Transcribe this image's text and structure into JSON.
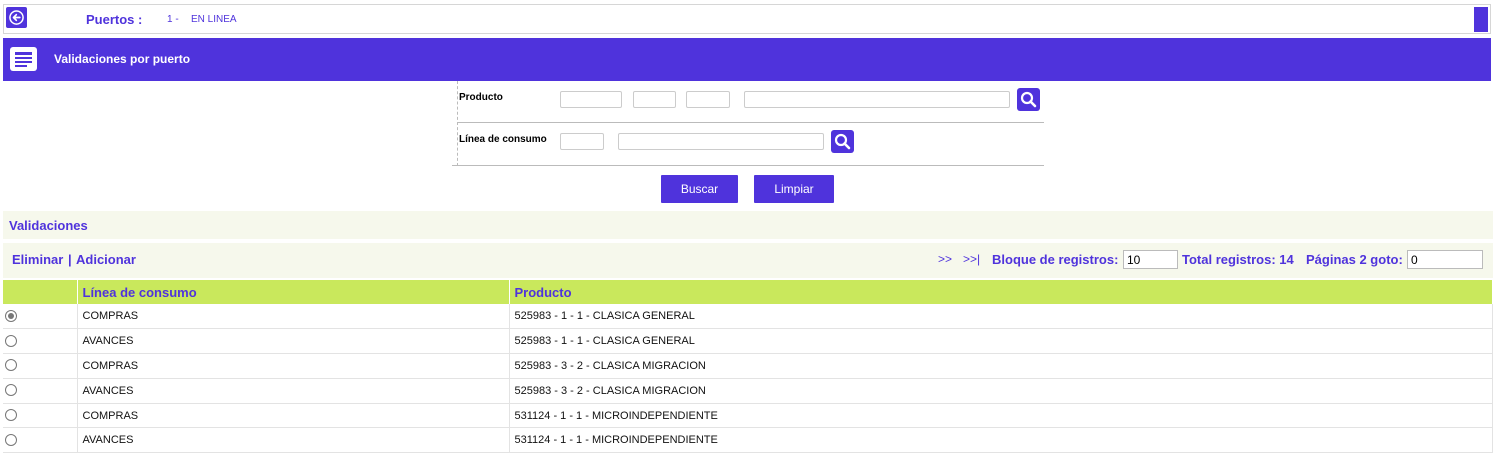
{
  "topbar": {
    "label": "Puertos :",
    "number": "1 -",
    "status": "EN LINEA"
  },
  "section": {
    "title": "Validaciones por puerto"
  },
  "filter": {
    "producto_label": "Producto",
    "linea_label": "Línea de consumo",
    "producto_values": [
      "",
      "",
      "",
      ""
    ],
    "linea_values": [
      "",
      ""
    ]
  },
  "actions": {
    "buscar": "Buscar",
    "limpiar": "Limpiar"
  },
  "validaciones": {
    "title": "Validaciones",
    "eliminar": "Eliminar",
    "separator": "|",
    "adicionar": "Adicionar",
    "next": ">>",
    "last": ">>|",
    "bloque_label": "Bloque de registros:",
    "bloque_value": "10",
    "total_label": "Total registros: 14",
    "paginas_label": "Páginas 2 goto:",
    "goto_value": "0"
  },
  "table": {
    "columns": [
      "",
      "Línea de consumo",
      "Producto"
    ],
    "rows": [
      {
        "selected": true,
        "linea": "COMPRAS",
        "producto": "525983 - 1 - 1 - CLASICA GENERAL"
      },
      {
        "selected": false,
        "linea": "AVANCES",
        "producto": "525983 - 1 - 1 - CLASICA GENERAL"
      },
      {
        "selected": false,
        "linea": "COMPRAS",
        "producto": "525983 - 3 - 2 - CLASICA MIGRACION"
      },
      {
        "selected": false,
        "linea": "AVANCES",
        "producto": "525983 - 3 - 2 - CLASICA MIGRACION"
      },
      {
        "selected": false,
        "linea": "COMPRAS",
        "producto": "531124 - 1 - 1 - MICROINDEPENDIENTE"
      },
      {
        "selected": false,
        "linea": "AVANCES",
        "producto": "531124 - 1 - 1 - MICROINDEPENDIENTE"
      }
    ]
  },
  "icons": {
    "back": "arrow-left-icon",
    "section": "list-form-icon",
    "search": "magnifier-icon"
  },
  "colors": {
    "accent": "#4f33dc",
    "header_green": "#c9e85c",
    "panel_bg": "#f6f8ec"
  }
}
